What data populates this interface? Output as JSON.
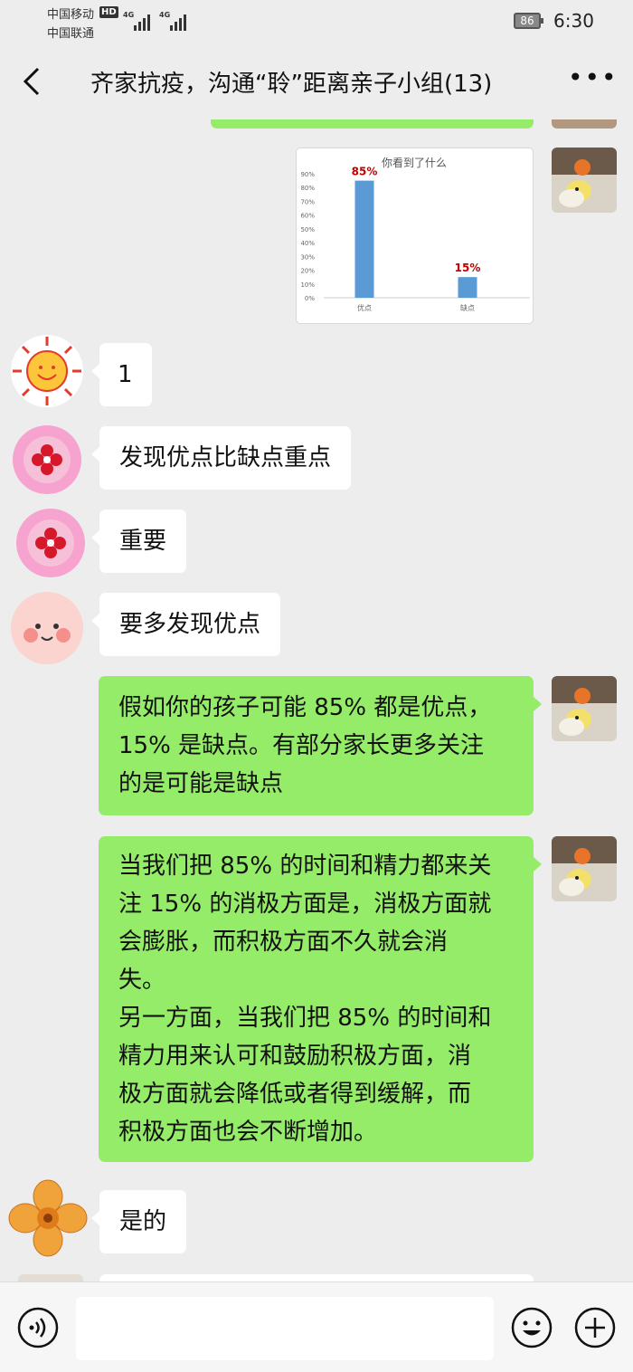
{
  "status_bar": {
    "carrier1": "中国移动",
    "carrier1_badge": "HD",
    "carrier2": "中国联通",
    "net1": "4G",
    "net2": "4G",
    "battery": "86",
    "time": "6:30"
  },
  "header": {
    "title": "齐家抗疫，沟通“聆”距离亲子小组(13)",
    "more_label": "•••"
  },
  "messages": [
    {
      "side": "right",
      "type": "chart"
    },
    {
      "side": "left",
      "text": "1"
    },
    {
      "side": "left",
      "text": "发现优点比缺点重点"
    },
    {
      "side": "left",
      "text": "重要"
    },
    {
      "side": "left",
      "text": "要多发现优点"
    },
    {
      "side": "right",
      "lines": [
        "假如你的孩子可能 85% 都是优点，",
        "15% 是缺点。有部分家长更多关注",
        "的是可能是缺点"
      ]
    },
    {
      "side": "right",
      "lines": [
        "当我们把 85% 的时间和精力都来关",
        "注 15% 的消极方面是，消极方面就",
        "会膨胀，而积极方面不久就会消",
        "失。",
        "另一方面，当我们把 85% 的时间和",
        "精力用来认可和鼓励积极方面，消",
        "极方面就会降低或者得到缓解，而",
        "积极方面也会不断增加。"
      ]
    },
    {
      "side": "left",
      "text": "是的"
    }
  ],
  "chart_data": {
    "type": "bar",
    "title": "你看到了什么",
    "categories": [
      "优点",
      "缺点"
    ],
    "values": [
      85,
      15
    ],
    "data_labels": [
      "85%",
      "15%"
    ],
    "yticks": [
      "0%",
      "10%",
      "20%",
      "30%",
      "40%",
      "50%",
      "60%",
      "70%",
      "80%",
      "90%"
    ],
    "ylim": [
      0,
      90
    ],
    "bar_color": "#5b9bd5",
    "label_color": "#c00000",
    "grid": false
  },
  "input": {
    "placeholder": ""
  },
  "colors": {
    "my_bubble": "#95ec69",
    "their_bubble": "#ffffff",
    "background": "#ededed"
  },
  "icons": {
    "back": "chevron-left-icon",
    "more": "more-icon",
    "voice": "voice-icon",
    "emoji": "emoji-icon",
    "plus": "plus-icon"
  }
}
